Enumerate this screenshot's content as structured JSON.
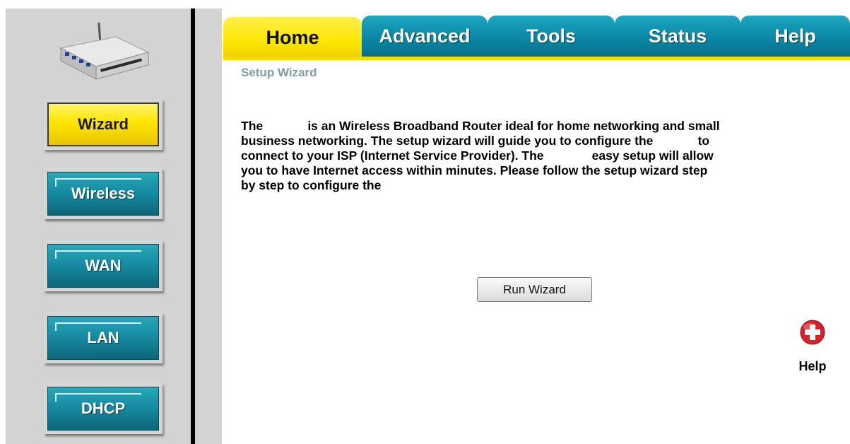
{
  "tabs": [
    {
      "label": "Home",
      "active": true
    },
    {
      "label": "Advanced",
      "active": false
    },
    {
      "label": "Tools",
      "active": false
    },
    {
      "label": "Status",
      "active": false
    },
    {
      "label": "Help",
      "active": false
    }
  ],
  "sidebar": {
    "router_icon": "router-icon",
    "buttons": [
      {
        "label": "Wizard",
        "active": true
      },
      {
        "label": "Wireless",
        "active": false
      },
      {
        "label": "WAN",
        "active": false
      },
      {
        "label": "LAN",
        "active": false
      },
      {
        "label": "DHCP",
        "active": false
      }
    ]
  },
  "main": {
    "section_title": "Setup Wizard",
    "intro_lines": [
      "The             is an Wireless Broadband Router ideal for home networking and small",
      "business networking. The setup wizard will guide you to configure the             to",
      "connect to your ISP (Internet Service Provider). The              easy setup will allow",
      "you to have Internet access within minutes. Please follow the setup wizard step",
      "by step to configure the"
    ],
    "run_wizard_label": "Run Wizard",
    "help_label": "Help",
    "help_icon": "help-plus-icon"
  },
  "colors": {
    "active_yellow": "#fde600",
    "tab_teal": "#0b88a6",
    "sidebar_gray": "#d3d3d3",
    "section_title": "#7f9ea8",
    "help_red": "#d8202a"
  }
}
